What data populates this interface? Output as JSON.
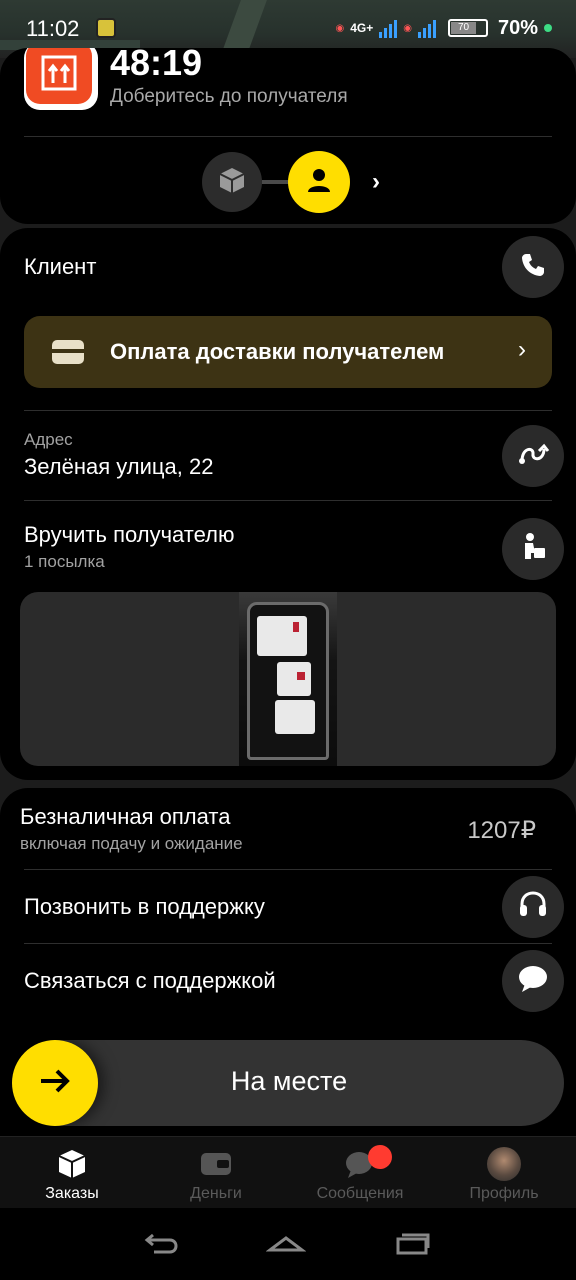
{
  "status_bar": {
    "time": "11:02",
    "network": "4G+",
    "battery_level": "70",
    "battery_percent": "70%"
  },
  "order_header": {
    "timer": "48:19",
    "instruction": "Доберитесь до получателя"
  },
  "client_row": {
    "label": "Клиент"
  },
  "payment_banner": {
    "label": "Оплата доставки получателем"
  },
  "address_row": {
    "caption": "Адрес",
    "value": "Зелёная улица, 22"
  },
  "handover_row": {
    "title": "Вручить получателю",
    "subtitle": "1 посылка"
  },
  "payment_summary": {
    "title": "Безналичная оплата",
    "subtitle": "включая подачу и ожидание",
    "amount": "1207₽"
  },
  "support": {
    "call_label": "Позвонить в поддержку",
    "chat_label": "Связаться с поддержкой"
  },
  "arrive_button": {
    "label": "На месте"
  },
  "bottom_nav": {
    "items": [
      {
        "label": "Заказы",
        "icon": "box-icon",
        "active": true
      },
      {
        "label": "Деньги",
        "icon": "wallet-icon",
        "active": false
      },
      {
        "label": "Сообщения",
        "icon": "chat-icon",
        "active": false
      },
      {
        "label": "Профиль",
        "icon": "avatar",
        "active": false
      }
    ]
  },
  "colors": {
    "accent": "#ffde00",
    "banner_bg": "#3d3314",
    "badge": "#ff3b30",
    "card_bg": "#000000"
  }
}
